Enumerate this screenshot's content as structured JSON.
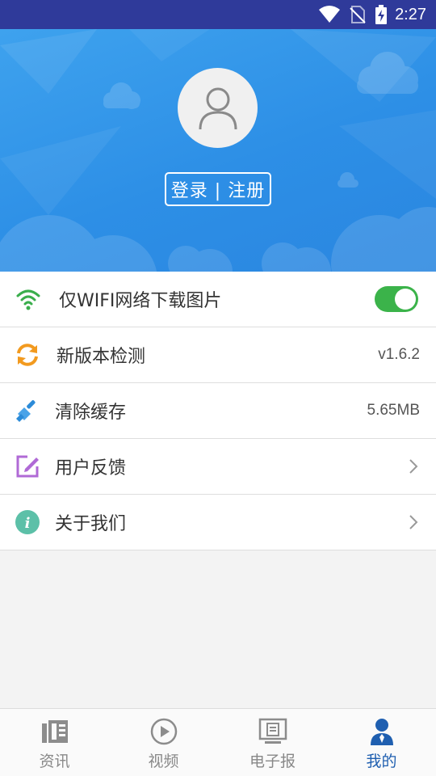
{
  "status_bar": {
    "time": "2:27"
  },
  "profile": {
    "login_label": "登录 | 注册"
  },
  "settings": {
    "wifi_only": {
      "label": "仅WIFI网络下载图片",
      "enabled": true,
      "icon": "wifi-icon"
    },
    "version_check": {
      "label": "新版本检测",
      "value": "v1.6.2",
      "icon": "refresh-icon"
    },
    "clear_cache": {
      "label": "清除缓存",
      "value": "5.65MB",
      "icon": "broom-icon"
    },
    "feedback": {
      "label": "用户反馈",
      "icon": "edit-icon"
    },
    "about": {
      "label": "关于我们",
      "icon": "info-icon"
    }
  },
  "colors": {
    "header": "#2d8fe6",
    "status_bar": "#2f3a9a",
    "toggle_on": "#3bb34a",
    "tab_active": "#1f5fb0"
  },
  "tabs": [
    {
      "label": "资讯",
      "icon": "news-icon",
      "active": false
    },
    {
      "label": "视频",
      "icon": "play-icon",
      "active": false
    },
    {
      "label": "电子报",
      "icon": "newspaper-icon",
      "active": false
    },
    {
      "label": "我的",
      "icon": "user-icon",
      "active": true
    }
  ]
}
